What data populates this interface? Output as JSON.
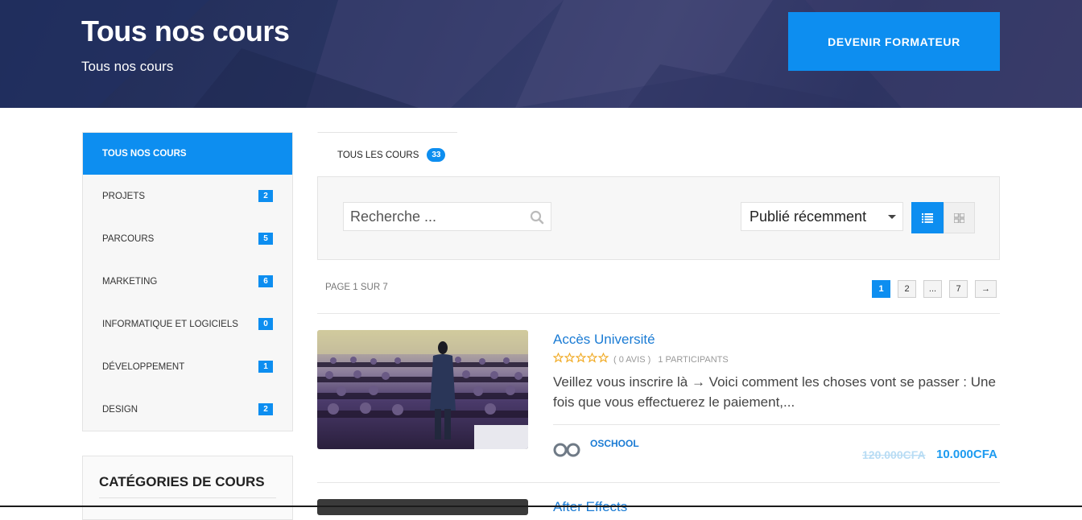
{
  "hero": {
    "title": "Tous nos cours",
    "subtitle": "Tous nos cours",
    "cta_label": "DEVENIR FORMATEUR"
  },
  "sidebar": {
    "items": [
      {
        "label": "TOUS NOS COURS",
        "count": ""
      },
      {
        "label": "PROJETS",
        "count": "2"
      },
      {
        "label": "PARCOURS",
        "count": "5"
      },
      {
        "label": "MARKETING",
        "count": "6"
      },
      {
        "label": "INFORMATIQUE ET LOGICIELS",
        "count": "0"
      },
      {
        "label": "DÉVELOPPEMENT",
        "count": "1"
      },
      {
        "label": "DESIGN",
        "count": "2"
      }
    ],
    "categories_title": "CATÉGORIES DE COURS"
  },
  "tabs": [
    {
      "label": "TOUS LES COURS",
      "count": "33"
    }
  ],
  "filter": {
    "search_placeholder": "Recherche ...",
    "sort_selected": "Publié récemment"
  },
  "pagination": {
    "label": "PAGE 1 SUR 7",
    "pages": [
      "1",
      "2",
      "...",
      "7"
    ],
    "next": "→"
  },
  "courses": [
    {
      "title": "Accès Université",
      "rating": 0,
      "reviews": "( 0 AVIS )",
      "participants": "1 PARTICIPANTS",
      "description": "Veillez vous inscrire là → Voici comment les choses vont se passer : Une fois que vous effectuerez le paiement,...",
      "author": "OSCHOOL",
      "price_old": "120.000CFA",
      "price_new": "10.000CFA"
    },
    {
      "title": "After Effects"
    }
  ],
  "colors": {
    "accent": "#0d8ef0",
    "link": "#1a7bd4",
    "hero_bg": "#2a3563"
  }
}
